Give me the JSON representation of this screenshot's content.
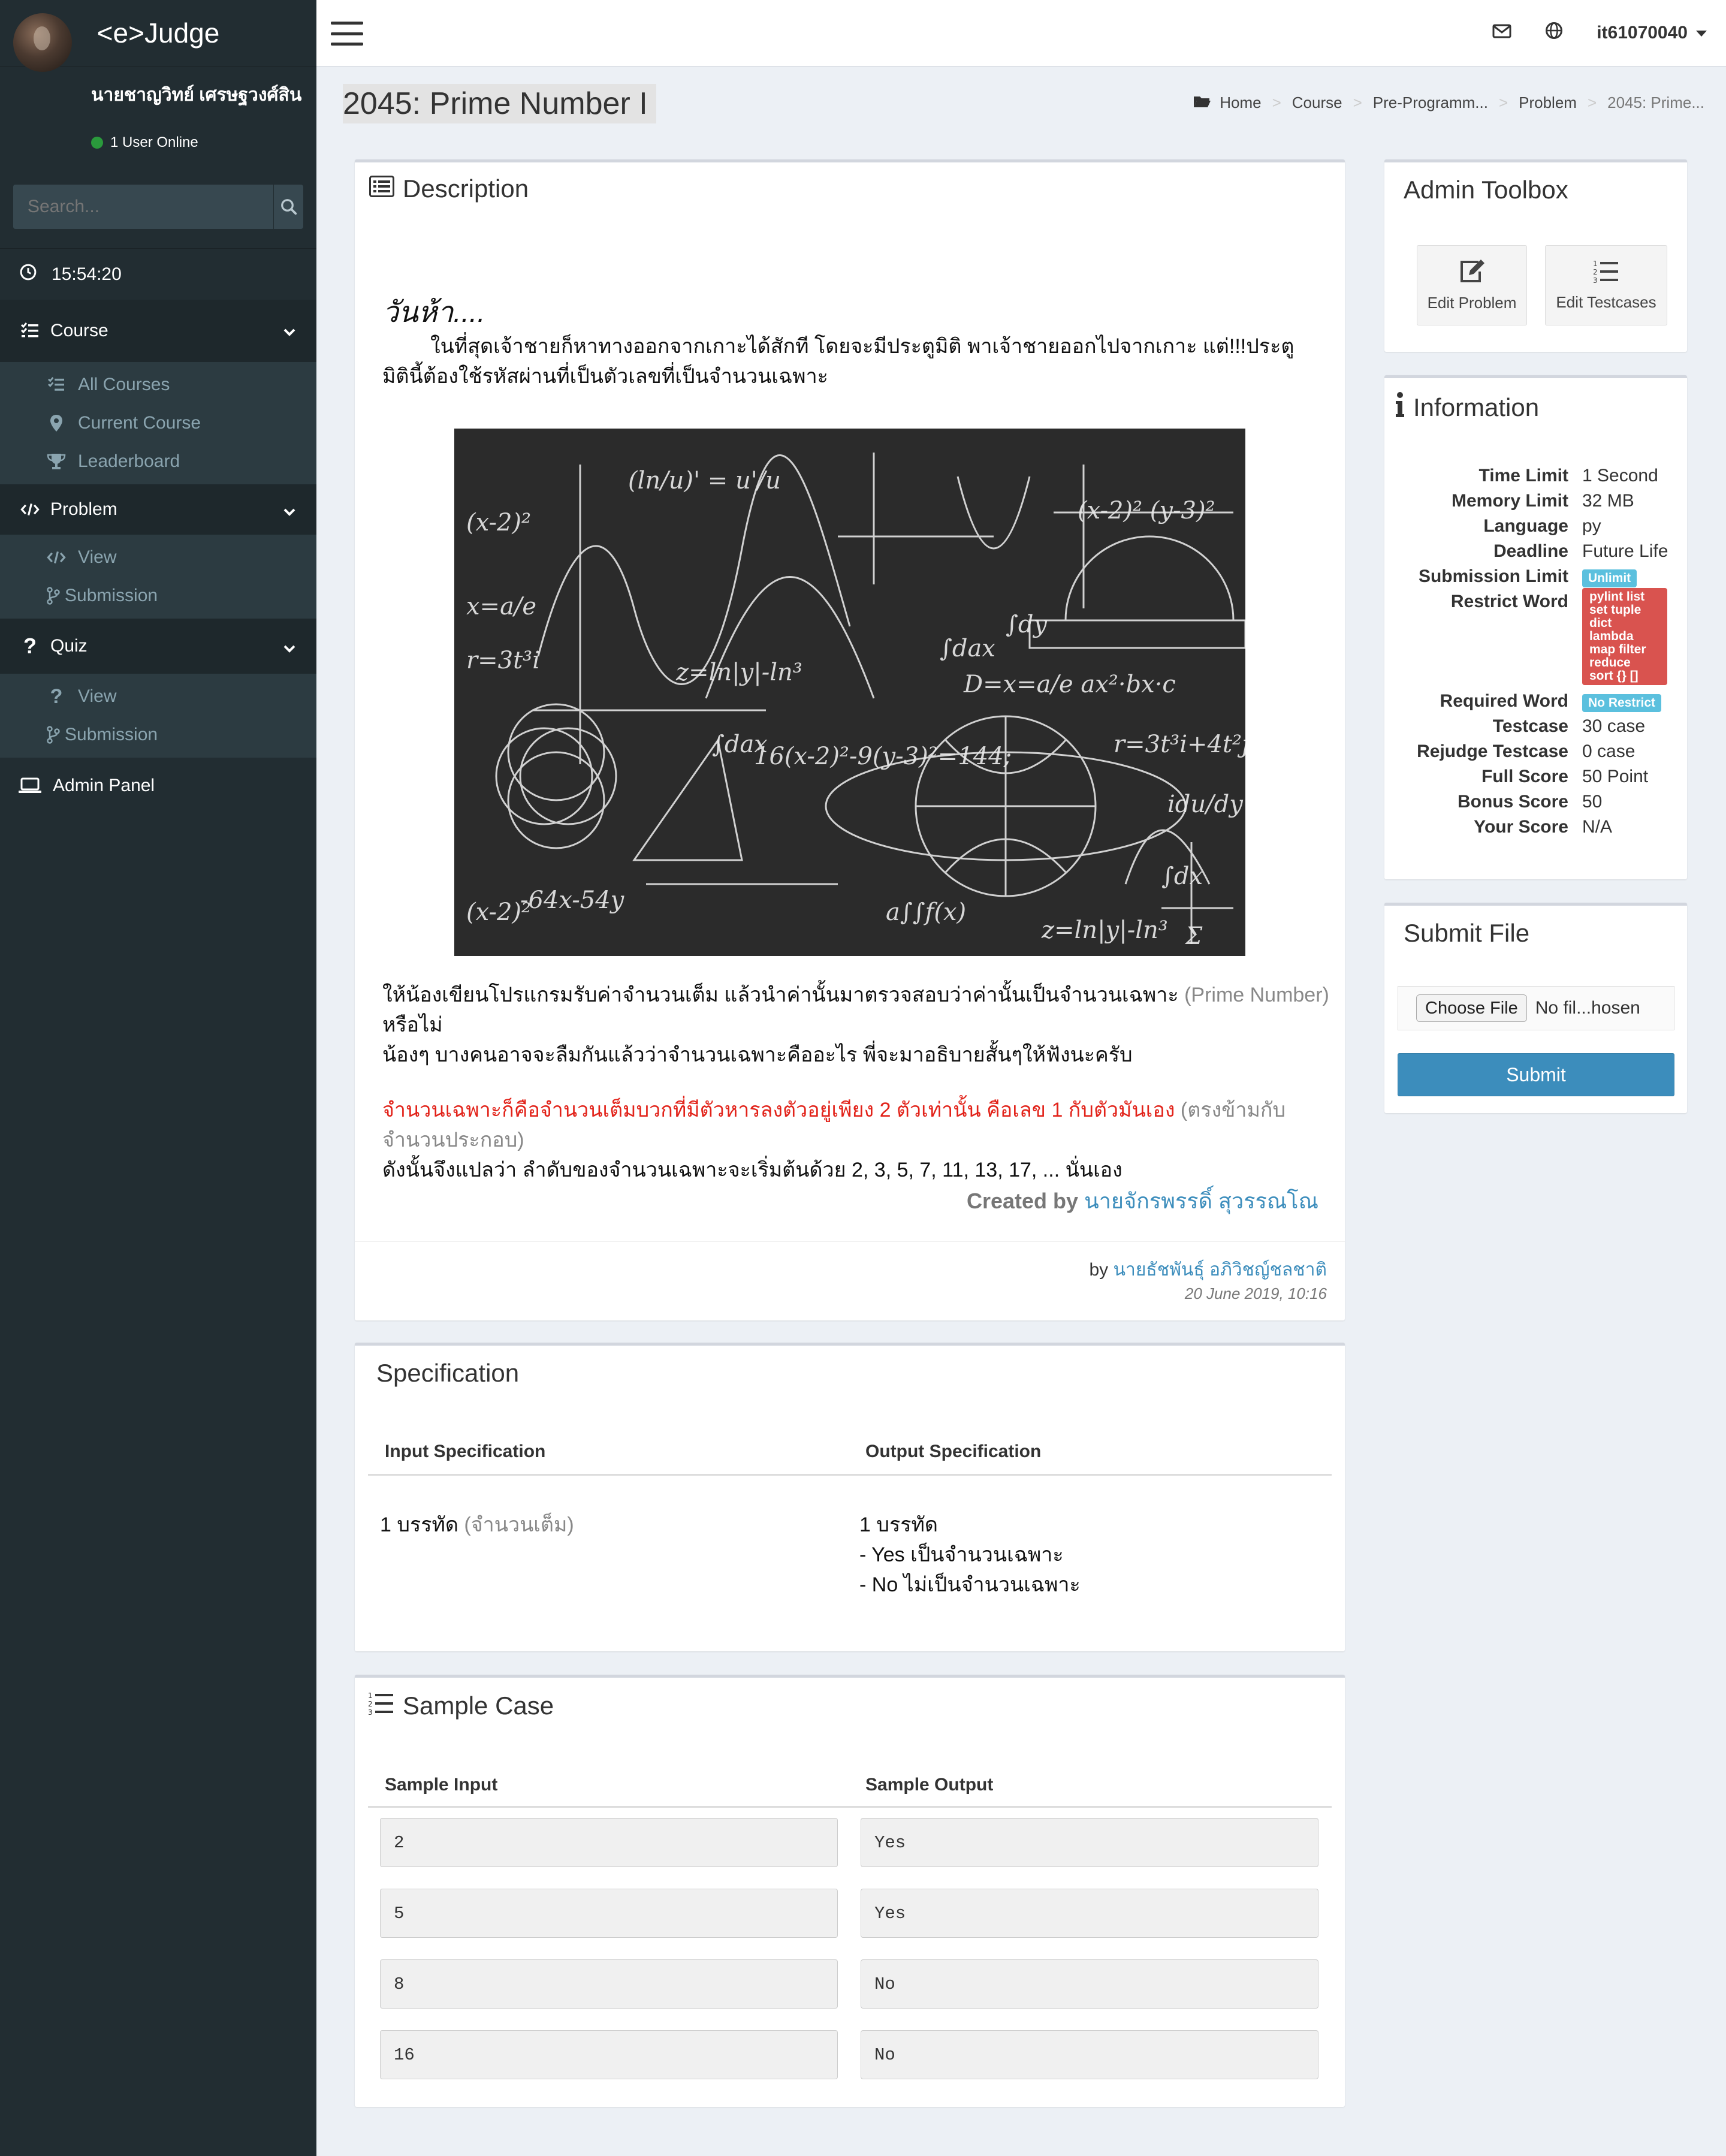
{
  "sidebar": {
    "logo": "<e>Judge",
    "user_name": "นายชาญวิทย์ เศรษฐวงศ์สิน",
    "user_status": "1 User Online",
    "search_placeholder": "Search...",
    "clock": "15:54:20",
    "course": {
      "label": "Course",
      "items": [
        "All Courses",
        "Current Course",
        "Leaderboard"
      ]
    },
    "problem": {
      "label": "Problem",
      "items": [
        "View",
        "Submission"
      ]
    },
    "quiz": {
      "label": "Quiz",
      "items": [
        "View",
        "Submission"
      ]
    },
    "admin_panel": "Admin Panel"
  },
  "navbar": {
    "username": "it61070040"
  },
  "page": {
    "title": "2045: Prime Number I",
    "breadcrumb": [
      "Home",
      "Course",
      "Pre-Programm...",
      "Problem",
      "2045: Prime..."
    ]
  },
  "description": {
    "title": "Description",
    "heading": "วันห้า....",
    "para1": "ในที่สุดเจ้าชายก็หาทางออกจากเกาะได้สักที โดยจะมีประตูมิติ พาเจ้าชายออกไปจากเกาะ แต่!!!ประตูมิตินี้ต้องใช้รหัสผ่านที่เป็นตัวเลขที่เป็นจำนวนเฉพาะ",
    "para2_main": "ให้น้องเขียนโปรแกรมรับค่าจำนวนเต็ม แล้วนำค่านั้นมาตรวจสอบว่าค่านั้นเป็นจำนวนเฉพาะ ",
    "para2_gray": "(Prime Number)",
    "para2_tail": " หรือไม่",
    "para3": "น้องๆ บางคนอาจจะลืมกันแล้วว่าจำนวนเฉพาะคืออะไร พี่จะมาอธิบายสั้นๆให้ฟังนะครับ",
    "para4_red": "จำนวนเฉพาะก็คือจำนวนเต็มบวกที่มีตัวหารลงตัวอยู่เพียง 2 ตัวเท่านั้น คือเลข 1 กับตัวมันเอง",
    "para4_gray": " (ตรงข้ามกับจำนวนประกอบ)",
    "para5": "ดังนั้นจึงแปลว่า ลำดับของจำนวนเฉพาะจะเริ่มต้นด้วย 2, 3, 5, 7, 11, 13, 17, ... นั่นเอง",
    "created_label": "Created by",
    "created_name": "นายจักรพรรดิ์ สุวรรณโณ",
    "by_label": "by",
    "by_name": "นายธัชพันธุ์ อภิวิชญ์ชลชาติ",
    "date": "20 June 2019, 10:16"
  },
  "specification": {
    "title": "Specification",
    "input_header": "Input Specification",
    "output_header": "Output Specification",
    "input_main": "1 บรรทัด",
    "input_gray": " (จำนวนเต็ม)",
    "output_lines": [
      "1 บรรทัด",
      "- Yes เป็นจำนวนเฉพาะ",
      "- No ไม่เป็นจำนวนเฉพาะ"
    ]
  },
  "sample": {
    "title": "Sample Case",
    "input_header": "Sample Input",
    "output_header": "Sample Output",
    "rows": [
      {
        "input": "2",
        "output": "Yes"
      },
      {
        "input": "5",
        "output": "Yes"
      },
      {
        "input": "8",
        "output": "No"
      },
      {
        "input": "16",
        "output": "No"
      }
    ]
  },
  "admin_toolbox": {
    "title": "Admin Toolbox",
    "edit_problem": "Edit Problem",
    "edit_testcases": "Edit Testcases"
  },
  "information": {
    "title": "Information",
    "time_limit_label": "Time Limit",
    "time_limit": "1 Second",
    "memory_limit_label": "Memory Limit",
    "memory_limit": "32 MB",
    "language_label": "Language",
    "language": "py",
    "deadline_label": "Deadline",
    "deadline": "Future Life",
    "submission_limit_label": "Submission Limit",
    "submission_limit": "Unlimit",
    "restrict_word_label": "Restrict Word",
    "restrict_words": [
      "pylint list",
      "set tuple",
      "dict",
      "lambda",
      "map filter",
      "reduce",
      "sort {} []"
    ],
    "required_word_label": "Required Word",
    "required_word": "No Restrict",
    "testcase_label": "Testcase",
    "testcase": "30 case",
    "rejudge_label": "Rejudge Testcase",
    "rejudge": "0 case",
    "full_score_label": "Full Score",
    "full_score": "50 Point",
    "bonus_score_label": "Bonus Score",
    "bonus_score": "50",
    "your_score_label": "Your Score",
    "your_score": "N/A"
  },
  "submit_file": {
    "title": "Submit File",
    "choose_file": "Choose File",
    "no_file": "No fil...hosen",
    "submit": "Submit"
  },
  "colors": {
    "sidebar": "#222d32",
    "accent": "#3c8dbc",
    "red": "#e2231a",
    "badge_blue": "#5bc0de",
    "badge_red": "#d9534f"
  }
}
